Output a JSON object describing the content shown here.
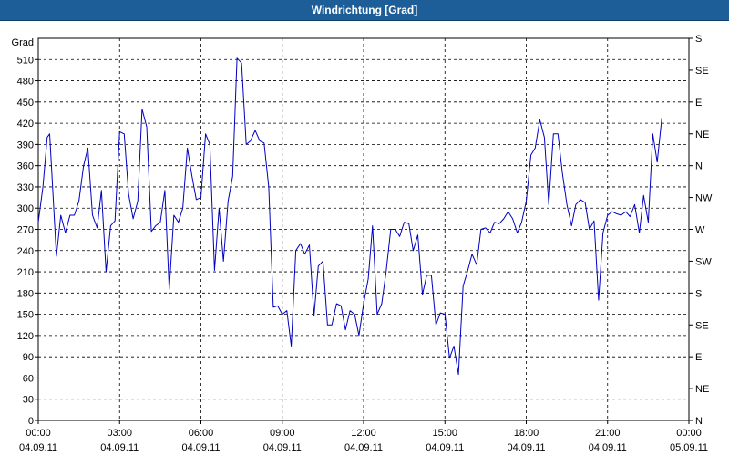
{
  "window": {
    "title": "Windrichtung [Grad]"
  },
  "chart_data": {
    "type": "line",
    "title": "Windrichtung [Grad]",
    "ylabel": "Grad",
    "ylim": [
      0,
      540
    ],
    "xlim": [
      "04.09.11 00:00",
      "05.09.11 00:00"
    ],
    "x_tick_labels": [
      {
        "time": "00:00",
        "date": "04.09.11"
      },
      {
        "time": "03:00",
        "date": "04.09.11"
      },
      {
        "time": "06:00",
        "date": "04.09.11"
      },
      {
        "time": "09:00",
        "date": "04.09.11"
      },
      {
        "time": "12:00",
        "date": "04.09.11"
      },
      {
        "time": "15:00",
        "date": "04.09.11"
      },
      {
        "time": "18:00",
        "date": "04.09.11"
      },
      {
        "time": "21:00",
        "date": "04.09.11"
      },
      {
        "time": "00:00",
        "date": "05.09.11"
      }
    ],
    "y_ticks": [
      0,
      30,
      60,
      90,
      120,
      150,
      180,
      210,
      240,
      270,
      300,
      330,
      360,
      390,
      420,
      450,
      480,
      510
    ],
    "right_axis_labels": [
      {
        "value": 0,
        "label": "N"
      },
      {
        "value": 30,
        "label": "NE"
      },
      {
        "value": 60,
        "label": "E"
      },
      {
        "value": 90,
        "label": "SE"
      },
      {
        "value": 120,
        "label": "S"
      },
      {
        "value": 150,
        "label": "SW"
      },
      {
        "value": 180,
        "label": "W"
      },
      {
        "value": 210,
        "label": "NW"
      },
      {
        "value": 240,
        "label": "N"
      },
      {
        "value": 270,
        "label": "NE"
      },
      {
        "value": 300,
        "label": "E"
      },
      {
        "value": 330,
        "label": "SE"
      },
      {
        "value": 360,
        "label": "S"
      }
    ],
    "grid": true,
    "line_color": "#0000c0",
    "series": [
      {
        "x_hours": [
          0.0,
          0.17,
          0.33,
          0.42,
          0.67,
          0.83,
          1.0,
          1.17,
          1.33,
          1.5,
          1.67,
          1.83,
          2.0,
          2.17,
          2.33,
          2.5,
          2.67,
          2.83,
          3.0,
          3.17,
          3.33,
          3.5,
          3.67,
          3.83,
          4.0,
          4.17,
          4.33,
          4.5,
          4.67,
          4.83,
          5.0,
          5.17,
          5.33,
          5.5,
          5.67,
          5.83,
          6.0,
          6.17,
          6.33,
          6.5,
          6.67,
          6.83,
          7.0,
          7.17,
          7.33,
          7.5,
          7.67,
          7.83,
          8.0,
          8.17,
          8.33,
          8.5,
          8.67,
          8.83,
          9.0,
          9.17,
          9.33,
          9.5,
          9.67,
          9.83,
          10.0,
          10.17,
          10.33,
          10.5,
          10.67,
          10.83,
          11.0,
          11.17,
          11.33,
          11.5,
          11.67,
          11.83,
          12.0,
          12.17,
          12.33,
          12.5,
          12.67,
          12.83,
          13.0,
          13.17,
          13.33,
          13.5,
          13.67,
          13.83,
          14.0,
          14.17,
          14.33,
          14.5,
          14.67,
          14.83,
          15.0,
          15.17,
          15.33,
          15.5,
          15.67,
          15.83,
          16.0,
          16.17,
          16.33,
          16.5,
          16.67,
          16.83,
          17.0,
          17.17,
          17.33,
          17.5,
          17.67,
          17.83,
          18.0,
          18.17,
          18.33,
          18.5,
          18.67,
          18.83,
          19.0,
          19.17,
          19.33,
          19.5,
          19.67,
          19.83,
          20.0,
          20.17,
          20.33,
          20.5,
          20.67,
          20.83,
          21.0,
          21.17,
          21.33,
          21.5,
          21.67,
          21.83,
          22.0,
          22.17,
          22.33,
          22.5,
          22.67,
          22.83,
          23.0,
          23.17,
          23.33,
          23.5,
          23.67,
          23.83,
          24.0
        ],
        "values": [
          280,
          330,
          400,
          405,
          232,
          290,
          265,
          290,
          290,
          310,
          360,
          385,
          290,
          272,
          325,
          210,
          275,
          282,
          408,
          405,
          320,
          285,
          310,
          440,
          415,
          267,
          275,
          280,
          325,
          185,
          290,
          280,
          300,
          385,
          345,
          312,
          315,
          405,
          390,
          212,
          300,
          225,
          310,
          345,
          512,
          505,
          390,
          395,
          410,
          395,
          392,
          330,
          160,
          162,
          150,
          155,
          105,
          240,
          250,
          235,
          248,
          148,
          218,
          225,
          135,
          135,
          165,
          162,
          128,
          155,
          150,
          120,
          165,
          200,
          275,
          150,
          165,
          210,
          270,
          270,
          260,
          280,
          278,
          240,
          262,
          178,
          205,
          205,
          135,
          152,
          150,
          88,
          105,
          65,
          190,
          210,
          235,
          220,
          270,
          272,
          265,
          280,
          278,
          285,
          295,
          285,
          265,
          280,
          310,
          375,
          385,
          425,
          400,
          305,
          405,
          405,
          350,
          305,
          275,
          305,
          312,
          308,
          270,
          282,
          170,
          265,
          290,
          295,
          292,
          290,
          295,
          288,
          305,
          265,
          318,
          280,
          405,
          365,
          428
        ]
      }
    ]
  }
}
